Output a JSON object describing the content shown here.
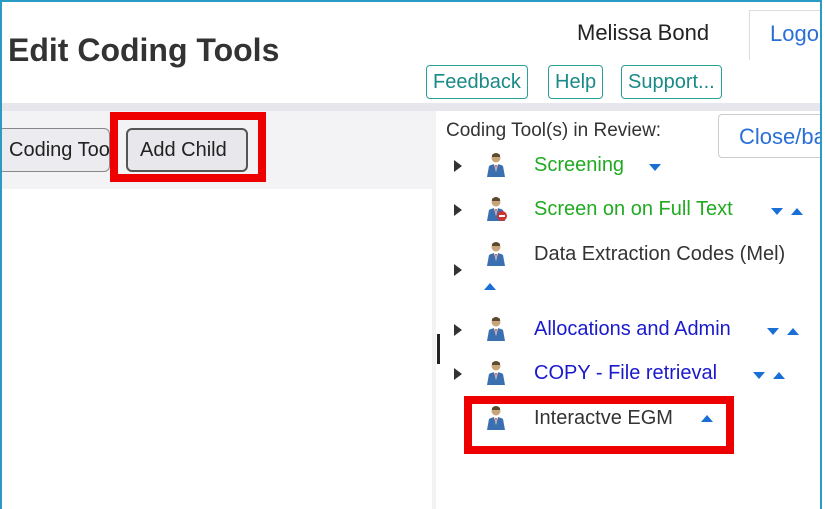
{
  "header": {
    "title": "Edit Coding Tools",
    "user_name": "Melissa Bond",
    "logout_label": "Logout",
    "buttons": {
      "feedback": "Feedback",
      "help": "Help",
      "support": "Support..."
    }
  },
  "toolbar": {
    "coding_tool_label": "Coding Tool",
    "add_child_label": "Add Child"
  },
  "review_panel": {
    "label": "Coding Tool(s) in Review:",
    "close_label": "Close/back",
    "items": [
      {
        "label": "Screening",
        "color": "#22aa22",
        "arrows": [
          "down"
        ]
      },
      {
        "label": "Screen on on Full Text",
        "color": "#22aa22",
        "arrows": [
          "down",
          "up"
        ]
      },
      {
        "label": "Data Extraction Codes (Mel)",
        "color": "#333333",
        "arrows": [
          "up"
        ]
      },
      {
        "label": "Allocations and Admin",
        "color": "#1a1acc",
        "arrows": [
          "down",
          "up"
        ]
      },
      {
        "label": "COPY - File retrieval",
        "color": "#1a1acc",
        "arrows": [
          "down",
          "up"
        ]
      },
      {
        "label": "Interactve EGM",
        "color": "#333333",
        "arrows": [
          "up"
        ]
      }
    ]
  },
  "colors": {
    "accent": "#2a9cc4",
    "highlight": "#ee0000",
    "link": "#2a6fd6"
  }
}
